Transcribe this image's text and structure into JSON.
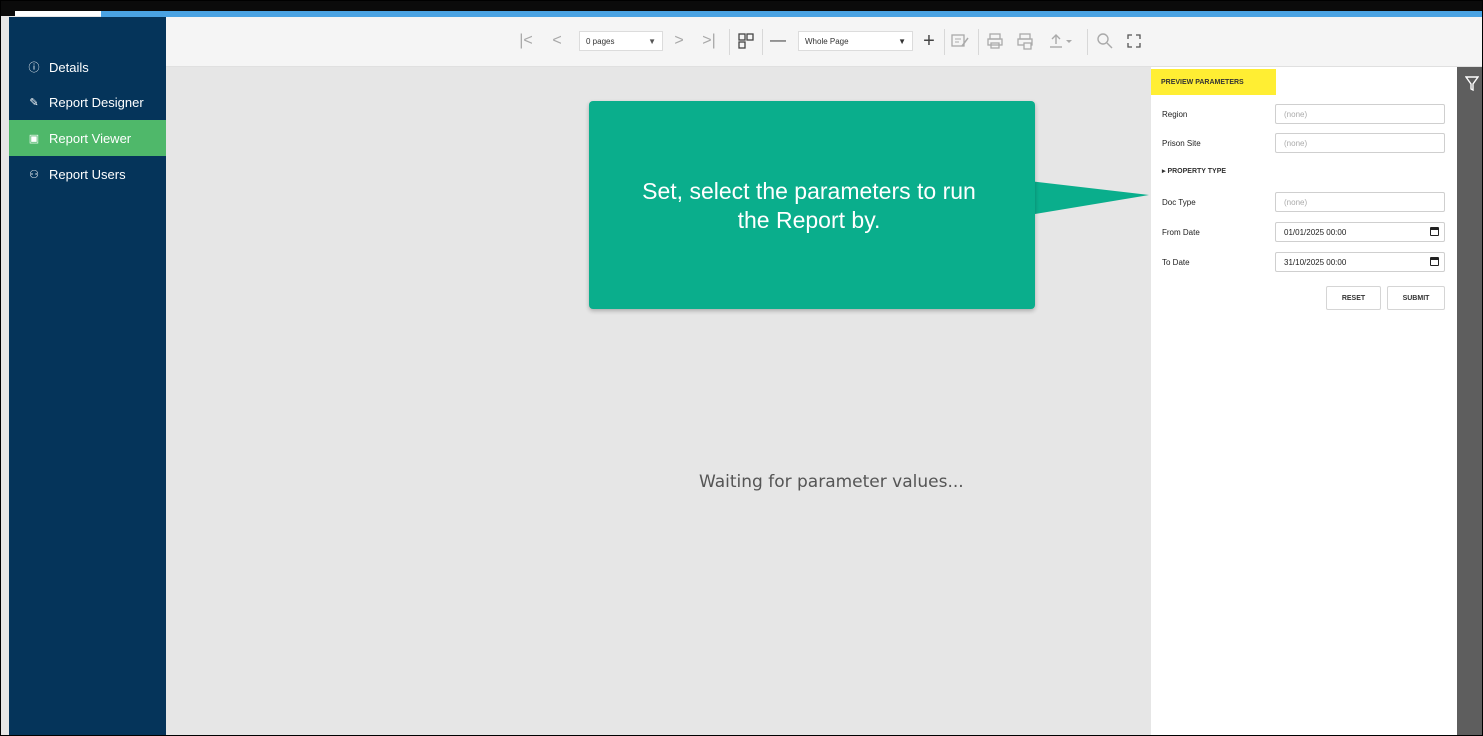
{
  "sidebar": {
    "items": [
      {
        "label": "Details",
        "icon": "info-icon",
        "glyph": "ⓘ"
      },
      {
        "label": "Report Designer",
        "icon": "edit-icon",
        "glyph": "✎"
      },
      {
        "label": "Report Viewer",
        "icon": "report-icon",
        "glyph": "▣",
        "active": true
      },
      {
        "label": "Report Users",
        "icon": "users-icon",
        "glyph": "⚇"
      }
    ]
  },
  "toolbar": {
    "pages_select": "0 pages",
    "zoom_select": "Whole Page"
  },
  "preview": {
    "waiting_text": "Waiting for parameter values..."
  },
  "callout": {
    "line1": "Set, select the parameters to run",
    "line2": "the Report by."
  },
  "params": {
    "title": "PREVIEW PARAMETERS",
    "region_label": "Region",
    "region_value": "(none)",
    "prison_label": "Prison Site",
    "prison_value": "(none)",
    "property_type": "▸ PROPERTY TYPE",
    "doctype_label": "Doc Type",
    "doctype_value": "(none)",
    "from_label": "From Date",
    "from_value": "01/01/2025 00:00",
    "to_label": "To Date",
    "to_value": "31/10/2025 00:00",
    "reset_label": "RESET",
    "submit_label": "SUBMIT"
  },
  "colors": {
    "sidebar_bg": "#05345a",
    "active_item": "#4fb86a",
    "callout_bg": "#0aae8c",
    "params_title_bg": "#ffee33"
  }
}
